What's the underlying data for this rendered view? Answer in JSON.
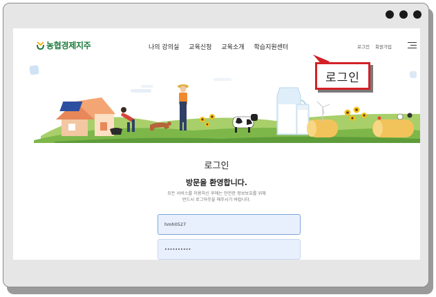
{
  "window": {
    "controls": [
      "dot-1",
      "dot-2",
      "dot-3"
    ]
  },
  "header": {
    "logo_text": "농협경제지주",
    "nav": [
      "나의 강의실",
      "교육신청",
      "교육소개",
      "학습지원센터"
    ],
    "util": {
      "login": "로그인",
      "separator": "·",
      "signup": "회원가입"
    },
    "menu_icon": "hamburger-menu-icon"
  },
  "callout": {
    "text": "로그인",
    "border_color": "#d32027"
  },
  "login": {
    "title": "로그인",
    "welcome": "방문을 환영합니다.",
    "desc_line1": "모든 서비스를 이용하신 후에는 안전한 정보보호를 위해",
    "desc_line2": "반드시 로그아웃을 해주시기 바랍니다.",
    "id_value": "hmh0527",
    "pw_value": "••••••••••"
  },
  "colors": {
    "brand_green": "#1c7a3c",
    "brand_yellow": "#f2b31b",
    "input_bg": "#e8f0fe"
  }
}
